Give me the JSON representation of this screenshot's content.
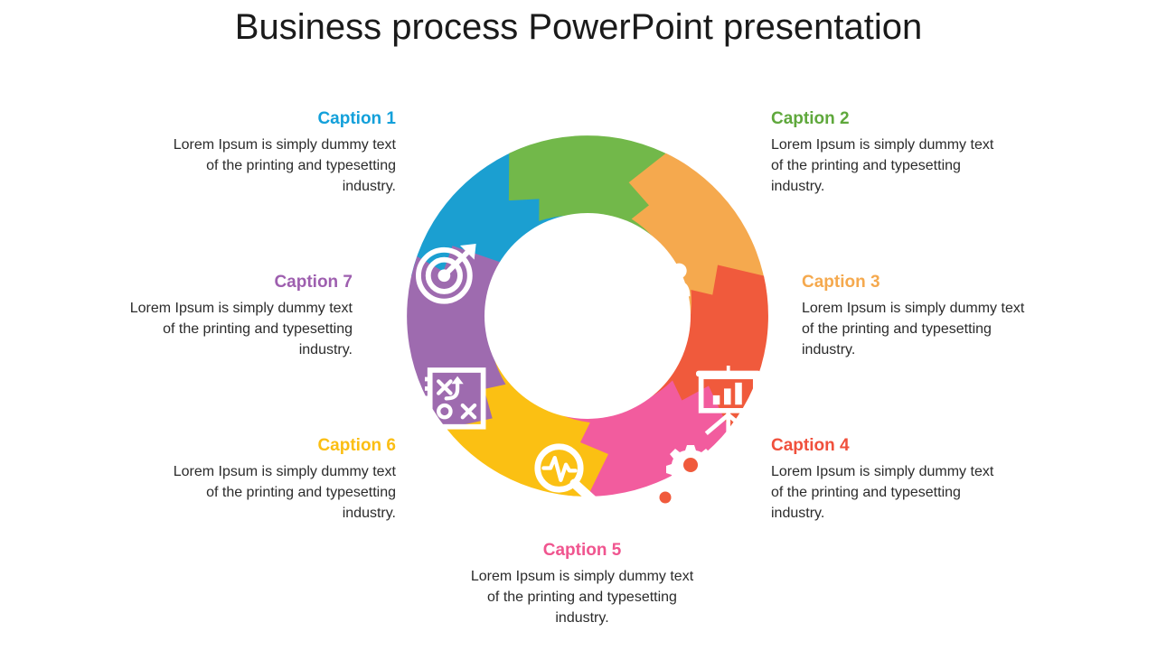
{
  "slide": {
    "title": "Business process PowerPoint presentation",
    "background": "#ffffff",
    "body_text": "Lorem Ipsum is simply dummy text of the printing and typesetting industry."
  },
  "diagram": {
    "type": "circular-process-wheel",
    "segment_count": 7,
    "inner_hole": "white",
    "segments": [
      {
        "index": 1,
        "caption": "Caption 1",
        "color": "#1B9FD1",
        "icon": "bar-chart-growth-icon",
        "position": "top"
      },
      {
        "index": 2,
        "caption": "Caption 2",
        "color": "#72B84A",
        "icon": "people-search-icon",
        "position": "top-right"
      },
      {
        "index": 3,
        "caption": "Caption 3",
        "color": "#F5A94E",
        "icon": "presentation-chart-icon",
        "position": "right"
      },
      {
        "index": 4,
        "caption": "Caption 4",
        "color": "#F05A3C",
        "icon": "gears-icon",
        "position": "bottom-right"
      },
      {
        "index": 5,
        "caption": "Caption 5",
        "color": "#F25C9E",
        "icon": "magnifier-pulse-icon",
        "position": "bottom"
      },
      {
        "index": 6,
        "caption": "Caption 6",
        "color": "#FBC013",
        "icon": "strategy-board-icon",
        "position": "bottom-left"
      },
      {
        "index": 7,
        "caption": "Caption 7",
        "color": "#9E6BAF",
        "icon": "target-arrow-icon",
        "position": "left"
      }
    ]
  },
  "captions": [
    {
      "id": "caption-1",
      "title": "Caption 1",
      "color": "#13A0DA",
      "body": "Lorem Ipsum is simply dummy text of the printing and typesetting industry.",
      "align": "right"
    },
    {
      "id": "caption-2",
      "title": "Caption 2",
      "color": "#5FA83C",
      "body": "Lorem Ipsum is simply dummy text of the printing and typesetting industry.",
      "align": "left"
    },
    {
      "id": "caption-3",
      "title": "Caption 3",
      "color": "#F5A94E",
      "body": "Lorem Ipsum is simply dummy text of the printing and typesetting industry.",
      "align": "left"
    },
    {
      "id": "caption-4",
      "title": "Caption 4",
      "color": "#F0503C",
      "body": "Lorem Ipsum is simply dummy text of the printing and typesetting industry.",
      "align": "left"
    },
    {
      "id": "caption-5",
      "title": "Caption 5",
      "color": "#F0558F",
      "body": "Lorem Ipsum is simply dummy text of the printing and typesetting industry.",
      "align": "center"
    },
    {
      "id": "caption-6",
      "title": "Caption 6",
      "color": "#FBBE13",
      "body": "Lorem Ipsum is simply dummy text of the printing and typesetting industry.",
      "align": "right"
    },
    {
      "id": "caption-7",
      "title": "Caption 7",
      "color": "#9E5FAF",
      "body": "Lorem Ipsum is simply dummy text of the printing and typesetting industry.",
      "align": "right"
    }
  ]
}
